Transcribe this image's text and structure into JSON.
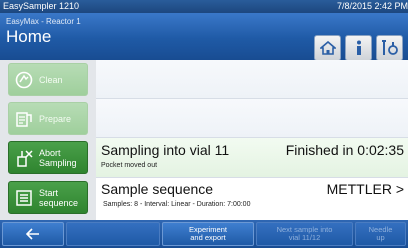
{
  "titlebar": {
    "app_name": "EasySampler 1210",
    "datetime": "7/8/2015 2:42 PM"
  },
  "header": {
    "breadcrumb": "EasyMax - Reactor 1",
    "title": "Home"
  },
  "sidebar": {
    "items": [
      {
        "label": "Clean",
        "state": "disabled",
        "icon": "clean-icon"
      },
      {
        "label": "Prepare",
        "state": "disabled",
        "icon": "prepare-icon"
      },
      {
        "label": "Abort\nSampling",
        "state": "active",
        "icon": "abort-sampling-icon"
      },
      {
        "label": "Start\nsequence",
        "state": "active",
        "icon": "start-sequence-icon"
      }
    ]
  },
  "status": {
    "sampling_text": "Sampling into vial 11",
    "finished_text": "Finished in 0:02:35",
    "pocket_text": "Pocket moved out",
    "sequence_title": "Sample sequence",
    "sequence_details": "Samples: 8 - Interval: Linear - Duration: 7:00:00",
    "brand": "METTLER >"
  },
  "bottombar": {
    "experiment_export": "Experiment\nand export",
    "next_sample": "Next sample into\nvial 11/12",
    "needle_up": "Needle\nup"
  },
  "colors": {
    "header_blue": "#1f5aa6",
    "active_green": "#2f842f",
    "disabled_green": "#a9d0a6"
  }
}
